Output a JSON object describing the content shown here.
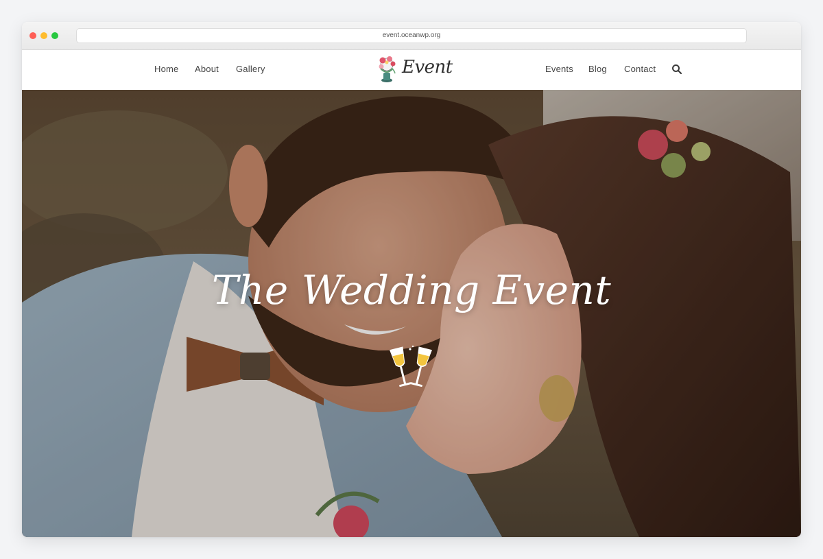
{
  "browser": {
    "url": "event.oceanwp.org"
  },
  "header": {
    "nav_left": [
      "Home",
      "About",
      "Gallery"
    ],
    "logo_text": "Event",
    "nav_right": [
      "Events",
      "Blog",
      "Contact"
    ],
    "search_icon": "search-icon"
  },
  "hero": {
    "title": "The Wedding Event",
    "icon": "champagne-glasses-icon"
  },
  "colors": {
    "nav_text": "#444444",
    "hero_text": "#ffffff",
    "champagne": "#f3c53f"
  }
}
